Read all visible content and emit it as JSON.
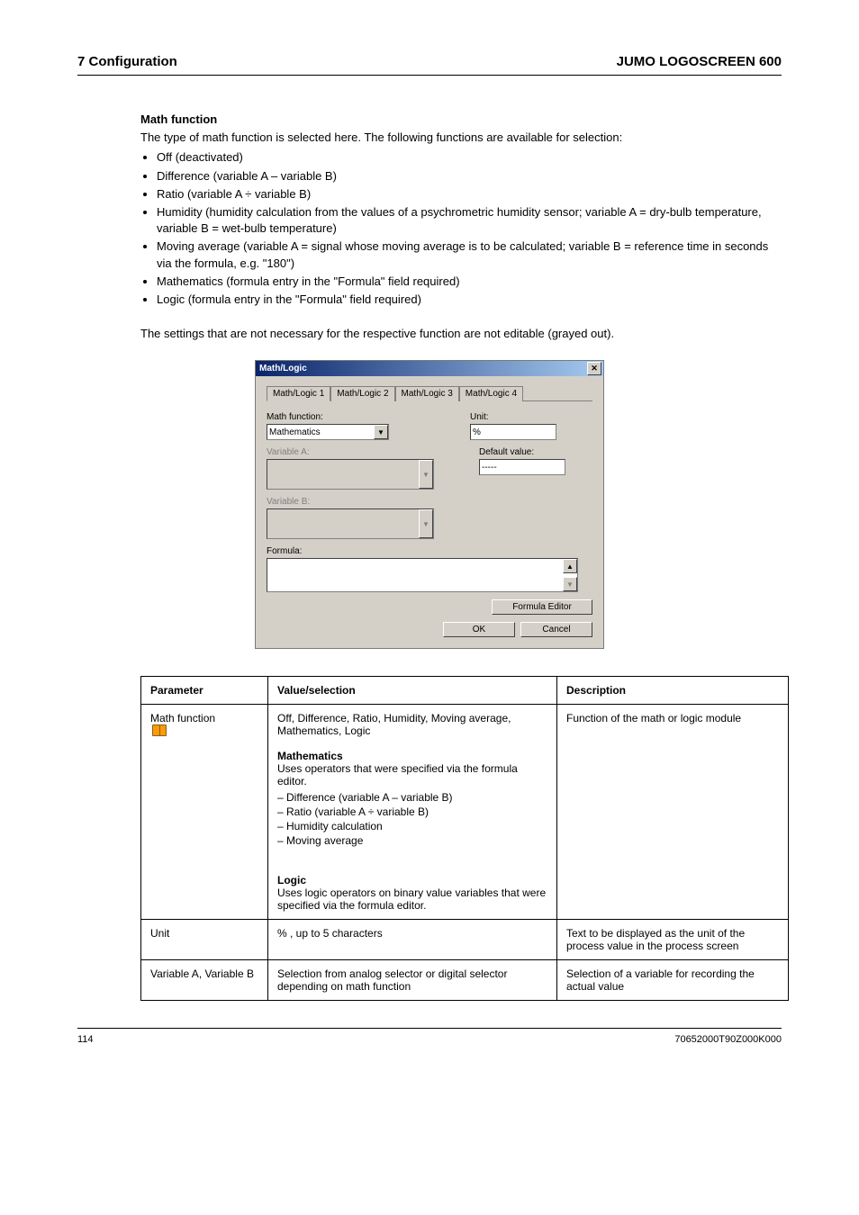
{
  "header": {
    "left": "7 Configuration",
    "right": "JUMO LOGOSCREEN 600"
  },
  "intro": {
    "heading": "Math function",
    "lead": "The type of math function is selected here. The following functions are available for selection:",
    "items": [
      "Off (deactivated)",
      "Difference (variable A – variable B)",
      "Ratio (variable A ÷ variable B)",
      "Humidity (humidity calculation from the values of a psychrometric humidity sensor; variable A = dry-bulb temperature, variable B = wet-bulb temperature)",
      "Moving average (variable A = signal whose moving average is to be calculated; variable B = reference time in seconds via the formula, e.g. \"180\")",
      "Mathematics (formula entry in the \"Formula\" field required)",
      "Logic (formula entry in the \"Formula\" field required)"
    ],
    "note": "The settings that are not necessary for the respective function are not editable (grayed out)."
  },
  "dialog": {
    "title": "Math/Logic",
    "tabs": [
      "Math/Logic 1",
      "Math/Logic 2",
      "Math/Logic 3",
      "Math/Logic 4"
    ],
    "labels": {
      "mathfn": "Math function:",
      "unit": "Unit:",
      "varA": "Variable A:",
      "defv": "Default value:",
      "varB": "Variable B:",
      "formula": "Formula:"
    },
    "values": {
      "mathfn": "Mathematics",
      "unit": "%",
      "defv": "-----"
    },
    "buttons": {
      "feditor": "Formula Editor",
      "ok": "OK",
      "cancel": "Cancel"
    }
  },
  "table": {
    "headers": [
      "Parameter",
      "Value/selection",
      "Description"
    ],
    "rows": [
      {
        "param": "Math function",
        "icon": true,
        "value_main": "Off, Difference, Ratio, Humidity, Moving average, Mathematics, Logic",
        "value_sub": [
          {
            "label": "Mathematics",
            "desc": "Uses operators that were specified via the formula editor.",
            "sub": [
              "Difference (variable A – variable B)",
              "Ratio (variable A ÷ variable B)",
              "Humidity calculation",
              "Moving average"
            ]
          },
          {
            "label": "Logic",
            "desc": "Uses logic operators on binary value variables that were specified via the formula editor."
          }
        ],
        "descr": "Function of the math or logic module"
      },
      {
        "param": "Unit",
        "value_main": "% , up to 5 characters",
        "descr": "Text to be displayed as the unit of the process value in the process screen"
      },
      {
        "param": "Variable A, Variable B",
        "value_main": "Selection from analog selector or digital selector depending on math function",
        "descr": "Selection of a variable for recording the actual value"
      }
    ]
  },
  "footer": {
    "left": "114",
    "right": "70652000T90Z000K000"
  }
}
